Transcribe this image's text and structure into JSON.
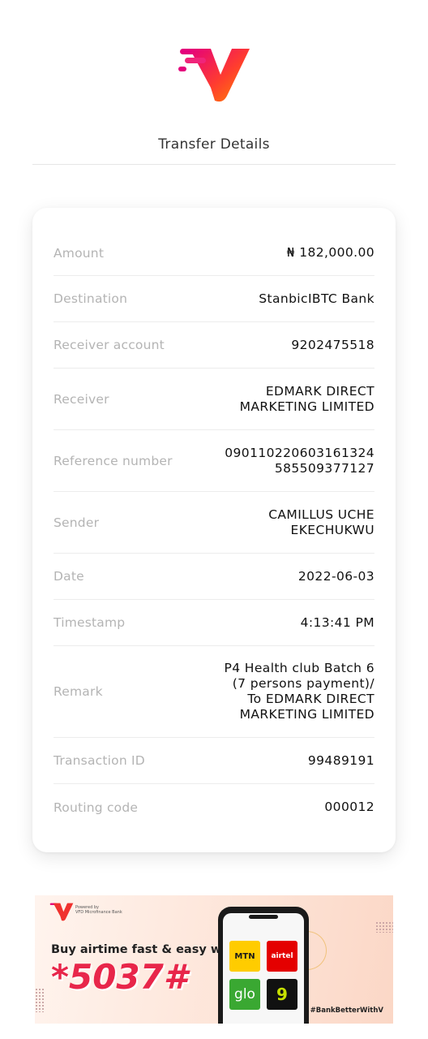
{
  "header": {
    "title": "Transfer Details",
    "logo_icon": "v-bank-logo-icon",
    "brand_colors": [
      "#e4007c",
      "#ff3d2e",
      "#ff8a00"
    ]
  },
  "details": [
    {
      "label": "Amount",
      "value": "₦ 182,000.00"
    },
    {
      "label": "Destination",
      "value": "StanbicIBTC Bank"
    },
    {
      "label": "Receiver account",
      "value": "9202475518"
    },
    {
      "label": "Receiver",
      "value": "EDMARK DIRECT\nMARKETING  LIMITED"
    },
    {
      "label": "Reference number",
      "value": "090110220603161324\n585509377127"
    },
    {
      "label": "Sender",
      "value": "CAMILLUS UCHE\nEKECHUKWU"
    },
    {
      "label": "Date",
      "value": "2022-06-03"
    },
    {
      "label": "Timestamp",
      "value": "4:13:41 PM"
    },
    {
      "label": "Remark",
      "value": "P4 Health club Batch 6\n(7 persons payment)/\nTo EDMARK DIRECT\nMARKETING  LIMITED"
    },
    {
      "label": "Transaction ID",
      "value": "99489191"
    },
    {
      "label": "Routing code",
      "value": "000012"
    }
  ],
  "banner": {
    "powered_by": "Powered by\nVFD Microfinance Bank",
    "tagline": "Buy airtime fast & easy with",
    "ussd_code": "*5037#",
    "hashtag": "#BankBetterWithV",
    "networks": [
      "MTN",
      "airtel",
      "glo",
      "9"
    ]
  }
}
